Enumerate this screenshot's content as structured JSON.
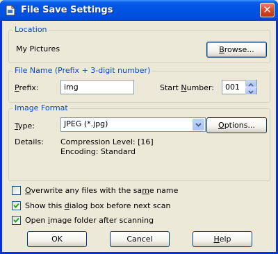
{
  "window": {
    "title": "File Save Settings",
    "close_label": "✕"
  },
  "location": {
    "label": "Location",
    "path": "My Pictures",
    "browse_pre": "",
    "browse_u": "B",
    "browse_post": "rowse..."
  },
  "file_name": {
    "label": "File Name (Prefix + 3-digit number)",
    "prefix_label_u": "P",
    "prefix_label_post": "refix:",
    "prefix_value": "img",
    "start_label_pre": "Start ",
    "start_label_u": "N",
    "start_label_post": "umber:",
    "start_value": "001"
  },
  "image_format": {
    "label": "Image Format",
    "type_label_u": "T",
    "type_label_post": "ype:",
    "type_value": "JPEG (*.jpg)",
    "options_u": "O",
    "options_post": "ptions...",
    "details_label": "Details:",
    "detail_line1": "Compression Level: [16]",
    "detail_line2": "Encoding: Standard"
  },
  "options": [
    {
      "pre": "",
      "u": "O",
      "post": "verwrite any files with the sa",
      "u2": "m",
      "post2": "e name",
      "checked": false
    },
    {
      "pre": "Show this ",
      "u": "d",
      "post": "ialog box before next scan",
      "u2": "",
      "post2": "",
      "checked": true
    },
    {
      "pre": "Open ",
      "u": "i",
      "post": "mage folder after scanning",
      "u2": "",
      "post2": "",
      "checked": true
    }
  ],
  "buttons": {
    "ok": "OK",
    "cancel": "Cancel",
    "help_u": "H",
    "help_post": "elp"
  }
}
